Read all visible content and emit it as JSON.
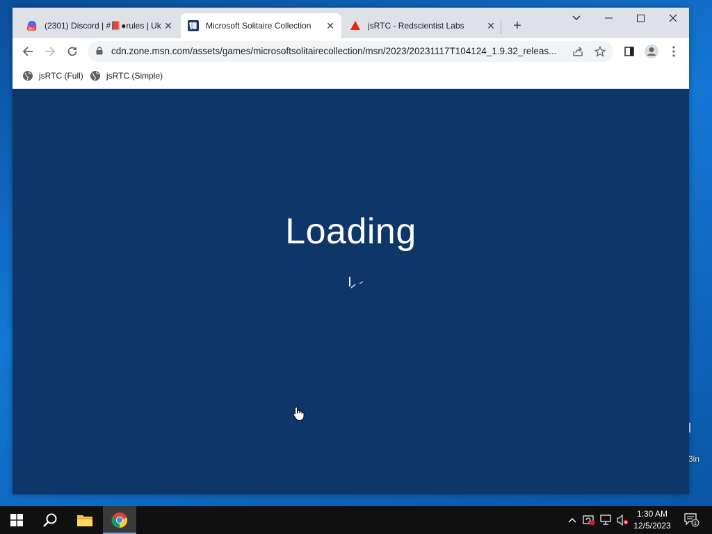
{
  "browser": {
    "tabs": [
      {
        "title": "(2301) Discord | #📕●rules | Uk",
        "badge": "2k+",
        "active": false
      },
      {
        "title": "Microsoft Solitaire Collection",
        "active": true
      },
      {
        "title": "jsRTC - Redscientist Labs",
        "active": false
      }
    ],
    "url": "cdn.zone.msn.com/assets/games/microsoftsolitairecollection/msn/2023/20231117T104124_1.9.32_releas...",
    "bookmarks": [
      "jsRTC (Full)",
      "jsRTC (Simple)"
    ],
    "accent_color": "#1a73e8"
  },
  "page": {
    "loading_text": "Loading",
    "background_color": "#0f3668"
  },
  "desktop": {
    "recycle_bin_label_fragment": "3in"
  },
  "taskbar": {
    "time": "1:30 AM",
    "date": "12/5/2023",
    "notification_count": "1",
    "pinned": [
      "start-icon",
      "search-icon",
      "file-explorer-icon",
      "chrome-icon"
    ]
  }
}
